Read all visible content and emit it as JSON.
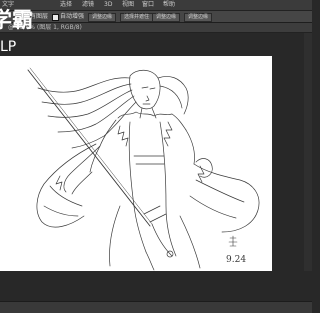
{
  "watermark": {
    "cn": "学霸",
    "en": "LP"
  },
  "menu": [
    "文字",
    "选择",
    "滤镜",
    "3D",
    "视图",
    "窗口",
    "帮助"
  ],
  "options": {
    "label_1": "所有图层",
    "auto_enhance": "自动增强",
    "btn_1": "调整边缘",
    "btn_2": "选择并遮住",
    "btn_3": "调整边缘",
    "btn_4": "调整边缘"
  },
  "document": {
    "tab_label": "@ 45.8% (图层 1, RGB/8)"
  },
  "artwork": {
    "signature_date": "9.24"
  },
  "colors": {
    "workspace": "#282828",
    "menubar": "#3b3b3b",
    "options_bar": "#464646",
    "canvas": "#ffffff"
  }
}
